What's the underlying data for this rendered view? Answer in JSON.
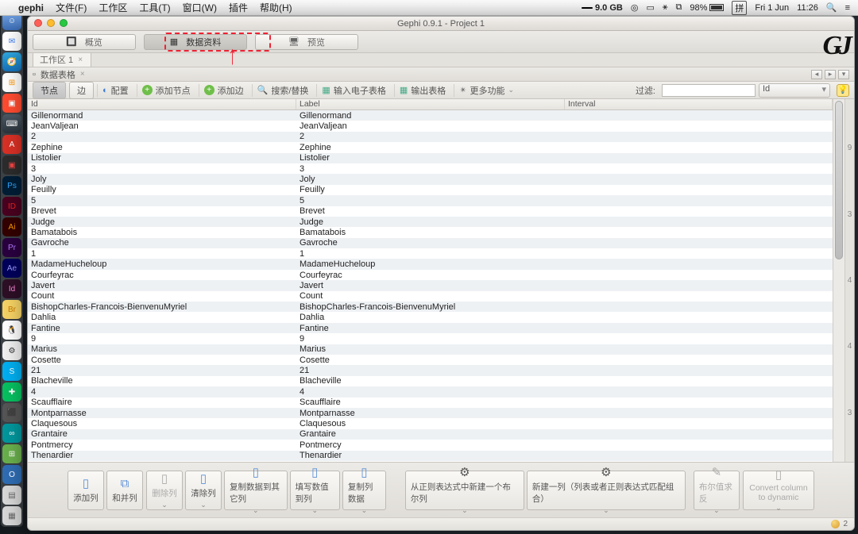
{
  "menubar": {
    "app": "gephi",
    "items": [
      "文件(F)",
      "工作区",
      "工具(T)",
      "窗口(W)",
      "插件",
      "帮助(H)"
    ],
    "right": {
      "mem": "9.0 GB",
      "battery": "98%",
      "ime": "拼",
      "date": "Fri 1 Jun",
      "time": "11:26"
    }
  },
  "window": {
    "title": "Gephi 0.9.1 - Project 1",
    "topTabs": {
      "overview": "概览",
      "data": "数据资料",
      "preview": "预览"
    },
    "workspaceTab": "工作区 1",
    "panelTitle": "数据表格"
  },
  "toolbar2": {
    "tabNodes": "节点",
    "tabEdges": "边",
    "config": "配置",
    "addNode": "添加节点",
    "addEdge": "添加边",
    "search": "搜索/替换",
    "import": "输入电子表格",
    "export": "输出表格",
    "more": "更多功能",
    "filterLabel": "过滤:",
    "filterColumn": "Id"
  },
  "columns": {
    "id": "Id",
    "label": "Label",
    "interval": "Interval"
  },
  "rows": [
    {
      "id": "Gillenormand",
      "label": "Gillenormand"
    },
    {
      "id": "JeanValjean",
      "label": "JeanValjean"
    },
    {
      "id": "2",
      "label": "2"
    },
    {
      "id": "Zephine",
      "label": "Zephine"
    },
    {
      "id": "Listolier",
      "label": "Listolier"
    },
    {
      "id": "3",
      "label": "3"
    },
    {
      "id": "Joly",
      "label": "Joly"
    },
    {
      "id": "Feuilly",
      "label": "Feuilly"
    },
    {
      "id": "5",
      "label": "5"
    },
    {
      "id": "Brevet",
      "label": "Brevet"
    },
    {
      "id": "Judge",
      "label": "Judge"
    },
    {
      "id": "Bamatabois",
      "label": "Bamatabois"
    },
    {
      "id": "Gavroche",
      "label": "Gavroche"
    },
    {
      "id": "1",
      "label": "1"
    },
    {
      "id": "MadameHucheloup",
      "label": "MadameHucheloup"
    },
    {
      "id": "Courfeyrac",
      "label": "Courfeyrac"
    },
    {
      "id": "Javert",
      "label": "Javert"
    },
    {
      "id": "Count",
      "label": "Count"
    },
    {
      "id": "BishopCharles-Francois-BienvenuMyriel",
      "label": "BishopCharles-Francois-BienvenuMyriel"
    },
    {
      "id": "Dahlia",
      "label": "Dahlia"
    },
    {
      "id": "Fantine",
      "label": "Fantine"
    },
    {
      "id": "9",
      "label": "9"
    },
    {
      "id": "Marius",
      "label": "Marius"
    },
    {
      "id": "Cosette",
      "label": "Cosette"
    },
    {
      "id": "21",
      "label": "21"
    },
    {
      "id": "Blacheville",
      "label": "Blacheville"
    },
    {
      "id": "4",
      "label": "4"
    },
    {
      "id": "Scaufflaire",
      "label": "Scaufflaire"
    },
    {
      "id": "Montparnasse",
      "label": "Montparnasse"
    },
    {
      "id": "Claquesous",
      "label": "Claquesous"
    },
    {
      "id": "Grantaire",
      "label": "Grantaire"
    },
    {
      "id": "Pontmercy",
      "label": "Pontmercy"
    },
    {
      "id": "Thenardier",
      "label": "Thenardier"
    }
  ],
  "sideNums": [
    "9",
    "3",
    "4",
    "4",
    "3"
  ],
  "bottom": {
    "addCol": "添加列",
    "merge": "和并列",
    "delCol": "删除列",
    "clearCol": "清除列",
    "copyOther": "复制数据到其它列",
    "fillVal": "填写数值到列",
    "copyData": "复制列数据",
    "regexBool": "从正则表达式中新建一个布尔列",
    "newCol": "新建一列（列表或者正则表达式匹配组合）",
    "boolNeg": "布尔值求反",
    "convDyn1": "Convert column",
    "convDyn2": "to dynamic"
  },
  "status": {
    "count": "2"
  }
}
